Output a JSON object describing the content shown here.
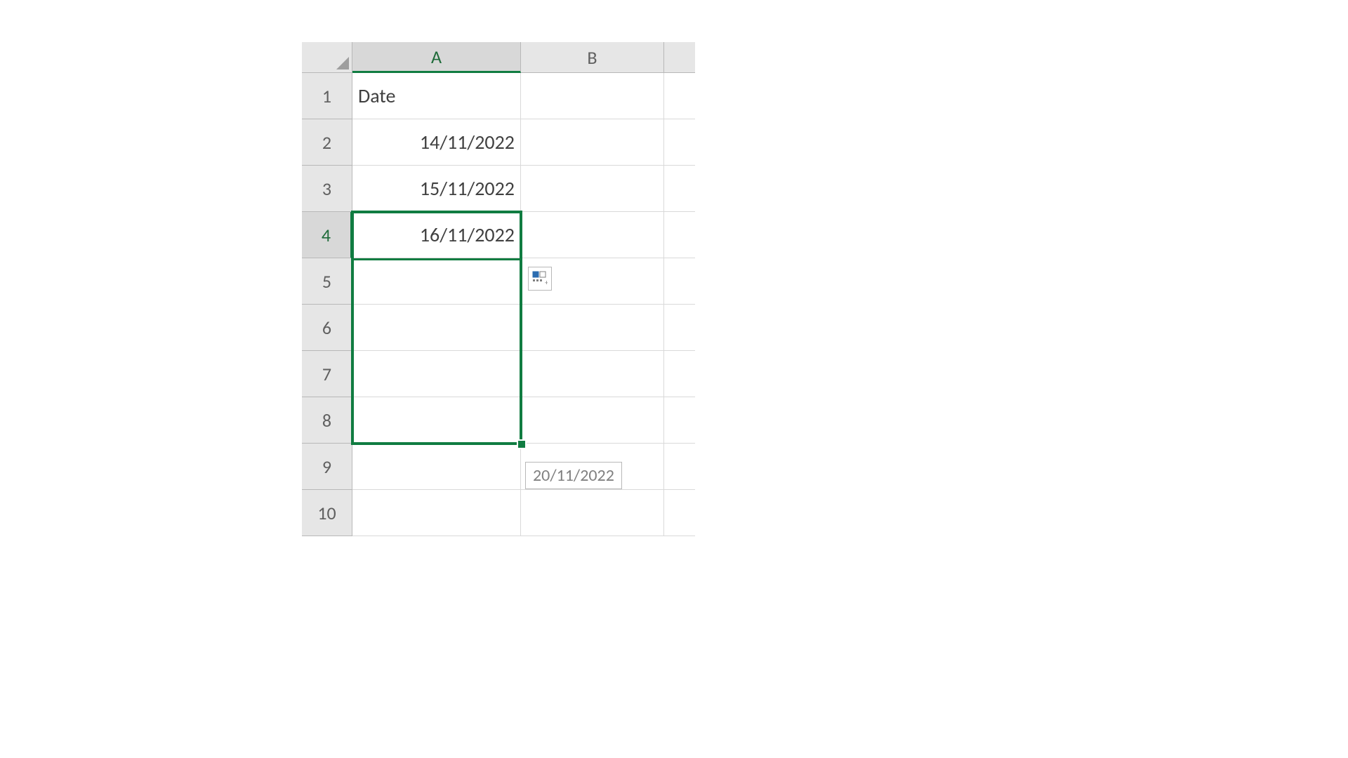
{
  "columns": {
    "A": "A",
    "B": "B"
  },
  "rows": [
    "1",
    "2",
    "3",
    "4",
    "5",
    "6",
    "7",
    "8",
    "9",
    "10"
  ],
  "selected_column": "A",
  "selected_row": "4",
  "cells": {
    "A1": "Date",
    "A2": "14/11/2022",
    "A3": "15/11/2022",
    "A4": "16/11/2022"
  },
  "selection_range": "A4:A8",
  "drag_tooltip": "20/11/2022",
  "autofill_icon": "autofill-options-icon",
  "colors": {
    "selection": "#107c41"
  }
}
